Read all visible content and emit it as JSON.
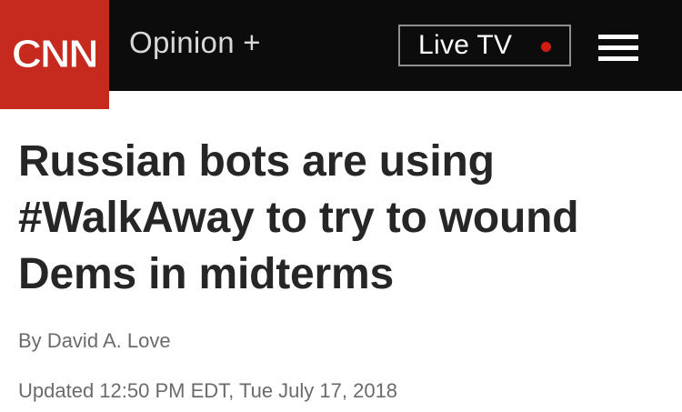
{
  "header": {
    "logo_text": "CNN",
    "section_label": "Opinion +",
    "live_tv_label": "Live TV",
    "menu_icon": "hamburger-menu-icon",
    "colors": {
      "bar": "#0c0c0c",
      "logo_bg": "#c62a1f",
      "live_dot": "#d01c12"
    }
  },
  "article": {
    "headline": "Russian bots are using #WalkAway to try to wound Dems in midterms",
    "byline_prefix": "By",
    "author": "David A. Love",
    "updated": "Updated 12:50 PM EDT, Tue July 17, 2018"
  }
}
